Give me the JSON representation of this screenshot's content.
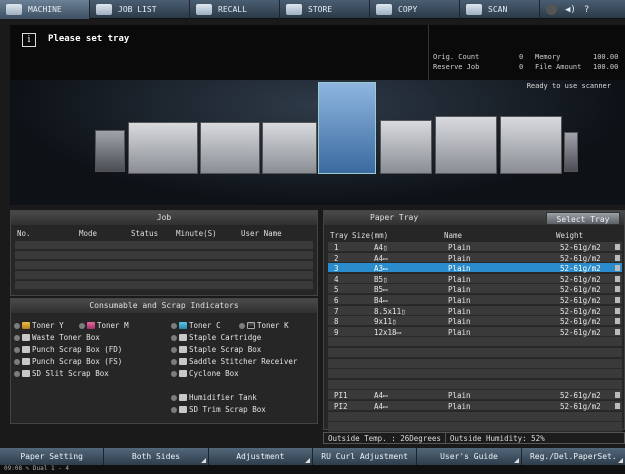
{
  "tabs": [
    {
      "label": "MACHINE",
      "active": true,
      "icon": "machine-icon"
    },
    {
      "label": "JOB LIST",
      "active": false,
      "icon": "job-list-icon"
    },
    {
      "label": "RECALL",
      "active": false,
      "icon": "recall-icon"
    },
    {
      "label": "STORE",
      "active": false,
      "icon": "store-icon"
    },
    {
      "label": "COPY",
      "active": false,
      "icon": "copy-icon"
    },
    {
      "label": "SCAN",
      "active": false,
      "icon": "scan-icon"
    }
  ],
  "message": {
    "text": "Please set tray",
    "icon": "info-icon"
  },
  "status": {
    "orig_count_label": "Orig. Count",
    "orig_count": "0",
    "memory_label": "Memory",
    "memory": "100.00",
    "reserve_job_label": "Reserve Job",
    "reserve_job": "0",
    "file_amount_label": "File Amount",
    "file_amount": "100.00",
    "ready": "Ready to use scanner"
  },
  "job": {
    "title": "Job",
    "columns": [
      "No.",
      "Mode",
      "Status",
      "Minute(S)",
      "User Name"
    ]
  },
  "consumables": {
    "title": "Consumable and Scrap Indicators",
    "items": [
      "Toner Y",
      "Toner M",
      "Toner C",
      "Toner K",
      "Waste Toner Box",
      "Staple Cartridge",
      "Punch Scrap Box (FD)",
      "Staple Scrap Box",
      "Punch Scrap Box (FS)",
      "Saddle Stitcher Receiver",
      "SD Slit Scrap Box",
      "Cyclone Box",
      "Humidifier Tank",
      "SD Trim Scrap Box"
    ]
  },
  "tray": {
    "title": "Paper Tray",
    "select_label": "Select Tray",
    "columns": [
      "Tray",
      "Size(mm)",
      "Name",
      "Weight"
    ],
    "rows": [
      {
        "tray": "1",
        "size": "A4▯",
        "name": "Plain",
        "weight": "52-61g/m2",
        "selected": false
      },
      {
        "tray": "2",
        "size": "A4▭",
        "name": "Plain",
        "weight": "52-61g/m2",
        "selected": false
      },
      {
        "tray": "3",
        "size": "A3▭",
        "name": "Plain",
        "weight": "52-61g/m2",
        "selected": true
      },
      {
        "tray": "4",
        "size": "B5▯",
        "name": "Plain",
        "weight": "52-61g/m2",
        "selected": false
      },
      {
        "tray": "5",
        "size": "B5▭",
        "name": "Plain",
        "weight": "52-61g/m2",
        "selected": false
      },
      {
        "tray": "6",
        "size": "B4▭",
        "name": "Plain",
        "weight": "52-61g/m2",
        "selected": false
      },
      {
        "tray": "7",
        "size": "8.5x11▯",
        "name": "Plain",
        "weight": "52-61g/m2",
        "selected": false
      },
      {
        "tray": "8",
        "size": "9x11▯",
        "name": "Plain",
        "weight": "52-61g/m2",
        "selected": false
      },
      {
        "tray": "9",
        "size": "12x18▭",
        "name": "Plain",
        "weight": "52-61g/m2",
        "selected": false
      },
      {
        "tray": "PI1",
        "size": "A4▭",
        "name": "Plain",
        "weight": "52-61g/m2",
        "selected": false
      },
      {
        "tray": "PI2",
        "size": "A4▭",
        "name": "Plain",
        "weight": "52-61g/m2",
        "selected": false
      }
    ]
  },
  "outside": {
    "temp_label": "Outside Temp.",
    "temp": "26Degrees",
    "humidity_label": "Outside Humidity:",
    "humidity": "52%"
  },
  "bottom_buttons": [
    "Paper Setting",
    "Both Sides",
    "Adjustment",
    "RU Curl Adjustment",
    "User's Guide",
    "Reg./Del.PaperSet."
  ],
  "footer": "09:08 ✎ Dual 1 - 4"
}
